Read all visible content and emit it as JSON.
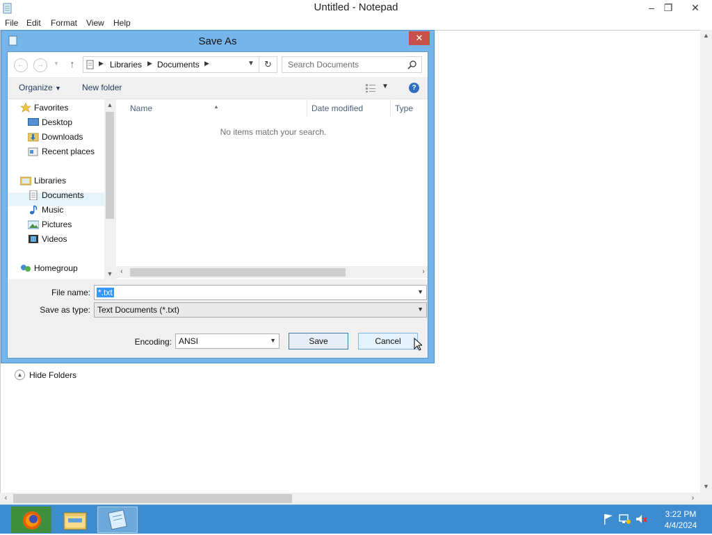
{
  "notepad": {
    "title": "Untitled - Notepad",
    "menu": [
      "File",
      "Edit",
      "Format",
      "View",
      "Help"
    ],
    "controls": {
      "minimize": "–",
      "restore": "❐",
      "close": "✕"
    }
  },
  "dialog": {
    "title": "Save As",
    "close": "✕",
    "breadcrumb": [
      "Libraries",
      "Documents"
    ],
    "search_placeholder": "Search Documents",
    "toolbar": {
      "organize": "Organize",
      "new_folder": "New folder"
    },
    "nav": {
      "favorites": "Favorites",
      "favorites_items": [
        "Desktop",
        "Downloads",
        "Recent places"
      ],
      "libraries": "Libraries",
      "libraries_items": [
        "Documents",
        "Music",
        "Pictures",
        "Videos"
      ],
      "homegroup": "Homegroup"
    },
    "columns": [
      "Name",
      "Date modified",
      "Type"
    ],
    "empty_message": "No items match your search.",
    "file_name_label": "File name:",
    "file_name_value": "*.txt",
    "save_type_label": "Save as type:",
    "save_type_value": "Text Documents (*.txt)",
    "encoding_label": "Encoding:",
    "encoding_value": "ANSI",
    "save_button": "Save",
    "cancel_button": "Cancel",
    "hide_folders": "Hide Folders"
  },
  "taskbar": {
    "time": "3:22 PM",
    "date": "4/4/2024"
  },
  "colors": {
    "dialog_frame": "#75b5ea",
    "taskbar": "#3d8ccf",
    "selection": "#3399ff",
    "close_button": "#c7504a"
  }
}
